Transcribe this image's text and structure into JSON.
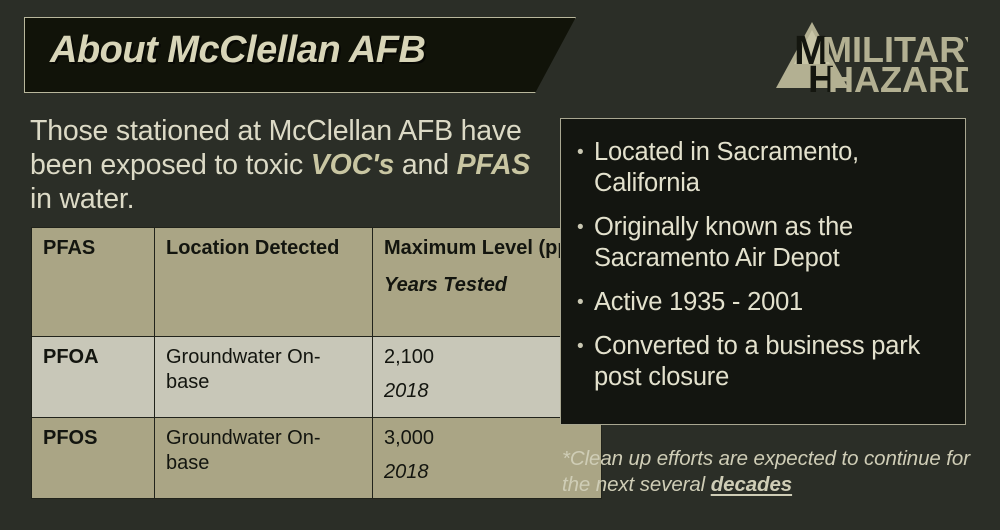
{
  "header": {
    "title": "About McClellan AFB",
    "logo": {
      "line1": "MILITARY",
      "line2": "HAZARDS",
      "icon": "triangle-mountain-icon"
    }
  },
  "intro": {
    "part1": "Those stationed at McClellan AFB have been exposed to toxic ",
    "highlight1": "VOC's",
    "part2": " and ",
    "highlight2": "PFAS",
    "part3": " in water."
  },
  "table": {
    "headers": {
      "col1": "PFAS",
      "col2": "Location Detected",
      "col3": "Maximum Level (ppt)",
      "col3_sub": "Years Tested"
    },
    "rows": [
      {
        "agent": "PFOA",
        "location": "Groundwater On-base",
        "level": "2,100",
        "year": "2018"
      },
      {
        "agent": "PFOS",
        "location": "Groundwater On-base",
        "level": "3,000",
        "year": "2018"
      }
    ]
  },
  "facts": {
    "bullet_glyph": "•",
    "items": [
      "Located in Sacramento, California",
      "Originally known as the Sacramento Air Depot",
      "Active 1935 - 2001",
      "Converted to a business park post closure"
    ]
  },
  "footnote": {
    "text": "*Clean up efforts are expected to continue for the next several ",
    "emphasis": "decades"
  },
  "colors": {
    "background": "#2b2e27",
    "panel_dark": "#131510",
    "accent_khaki": "#aaa585",
    "row_light": "#c8c7b8",
    "text_cream": "#e3e1cd",
    "border_light": "#a9a791"
  }
}
